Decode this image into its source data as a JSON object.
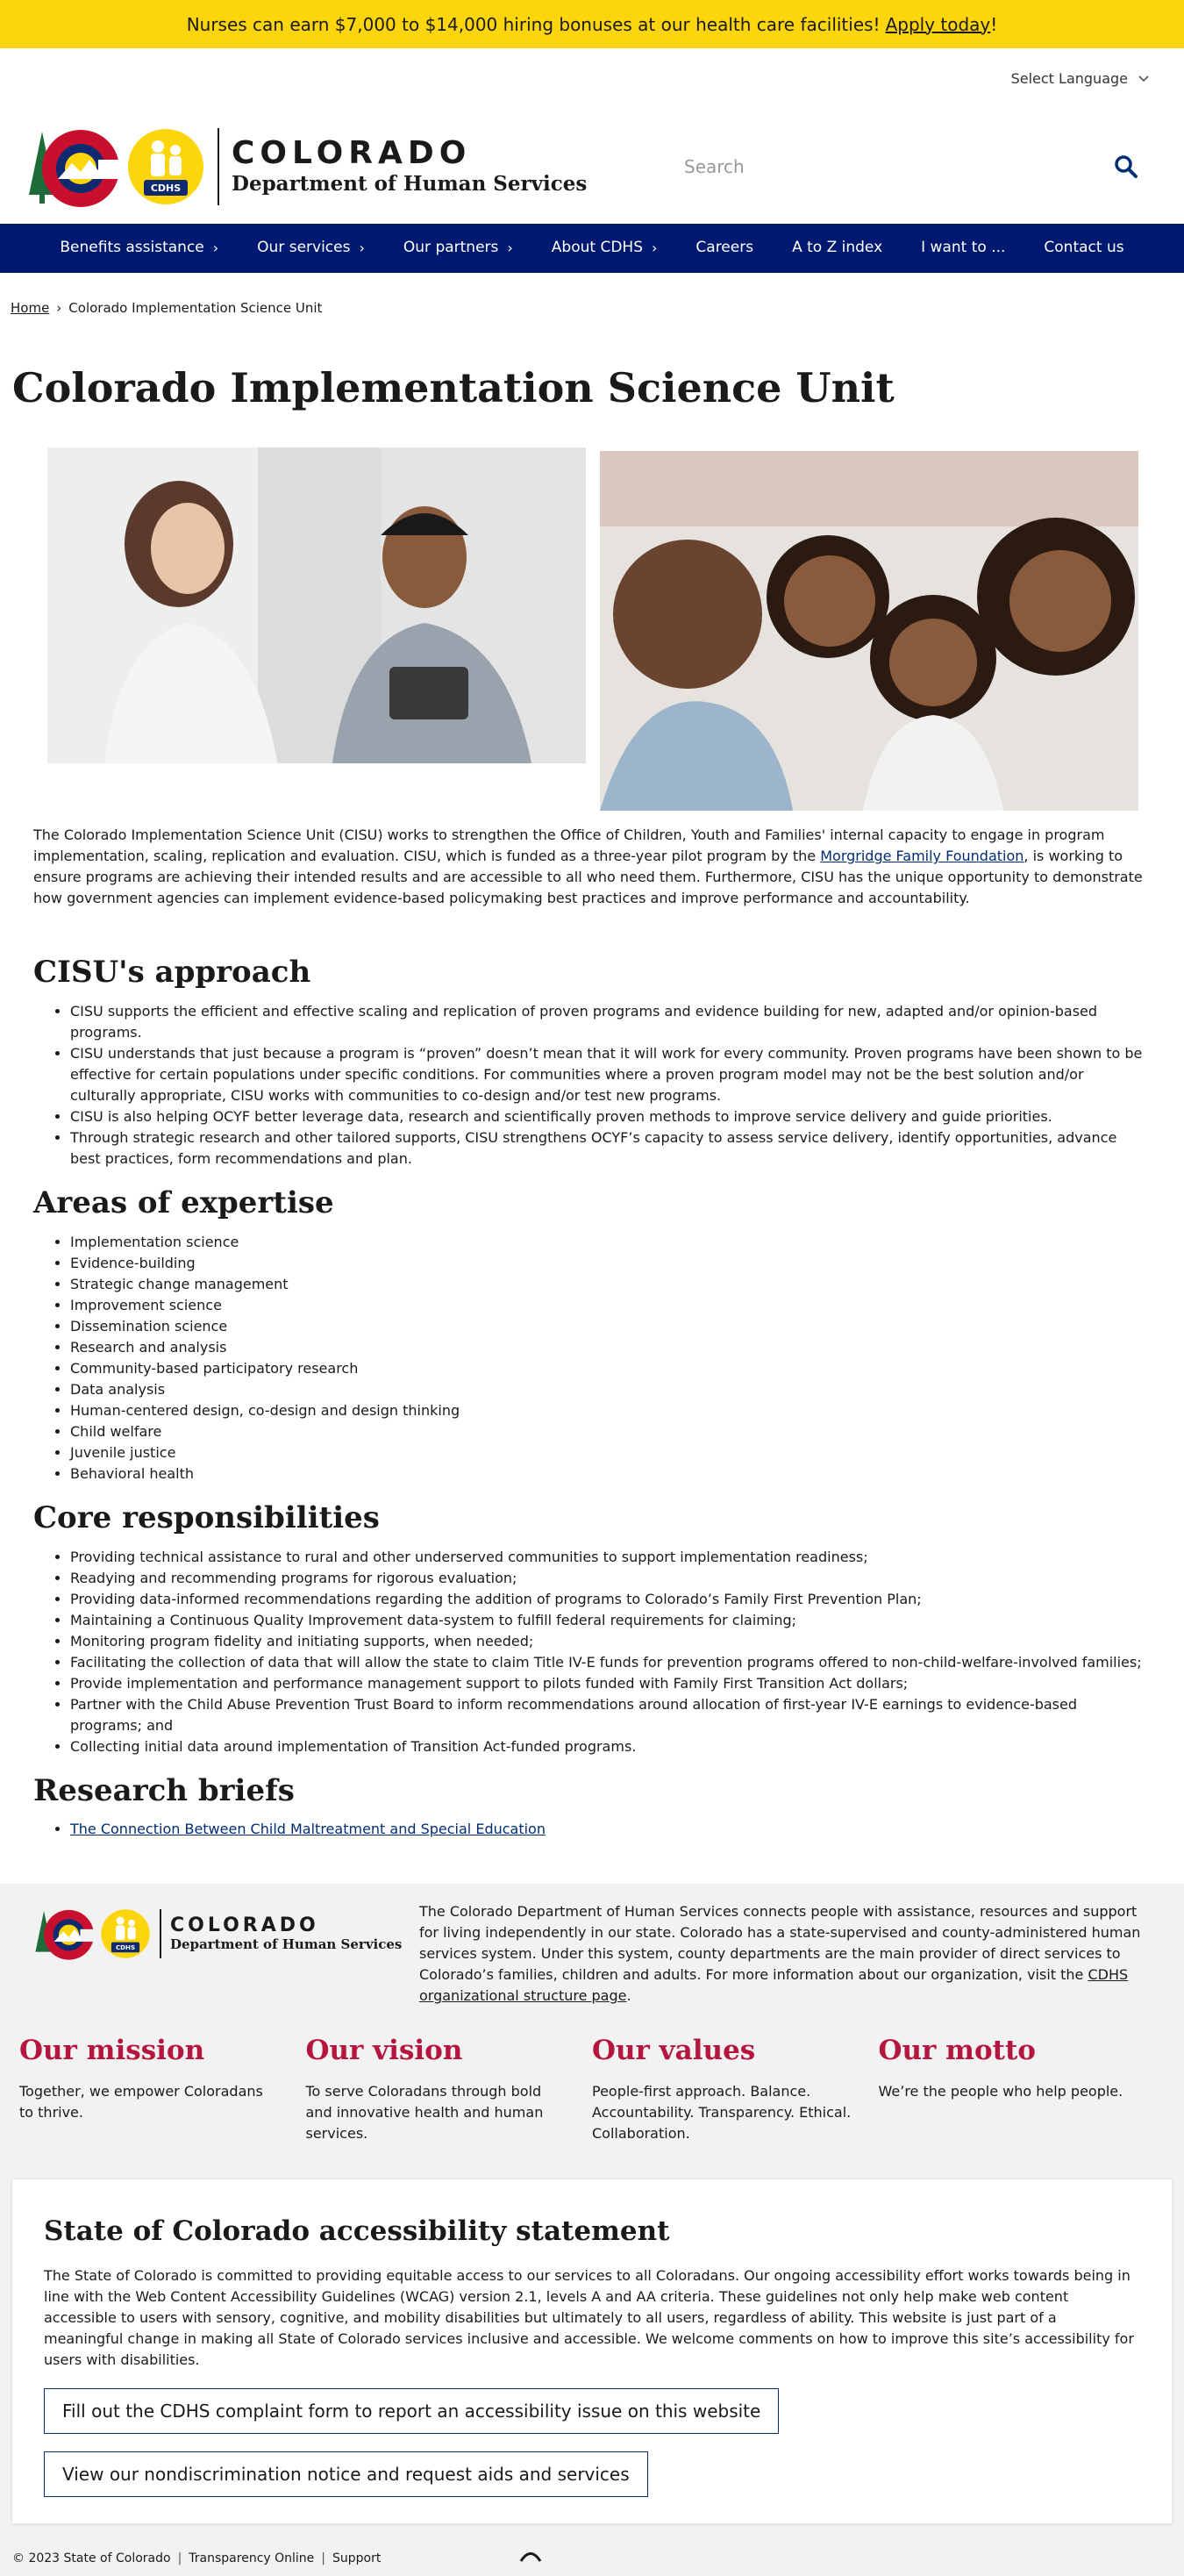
{
  "alert": {
    "text": "Nurses can earn $7,000 to $14,000 hiring bonuses at our health care facilities!",
    "link": "Apply today",
    "suffix": "!"
  },
  "header": {
    "language": "Select Language",
    "logo_title": "COLORADO",
    "logo_subtitle": "Department of Human Services",
    "cdhs_badge": "CDHS",
    "search_placeholder": "Search"
  },
  "nav": [
    {
      "label": "Benefits assistance",
      "has_chevron": true
    },
    {
      "label": "Our services",
      "has_chevron": true
    },
    {
      "label": "Our partners",
      "has_chevron": true
    },
    {
      "label": "About CDHS",
      "has_chevron": true
    },
    {
      "label": "Careers",
      "has_chevron": false
    },
    {
      "label": "A to Z index",
      "has_chevron": false
    },
    {
      "label": "I want to ...",
      "has_chevron": false
    },
    {
      "label": "Contact us",
      "has_chevron": false
    }
  ],
  "breadcrumb": {
    "home": "Home",
    "current": "Colorado Implementation Science Unit"
  },
  "page_title": "Colorado Implementation Science Unit",
  "intro": {
    "part1": "The Colorado Implementation Science Unit (CISU) works to strengthen the Office of Children, Youth and Families' internal capacity to engage in program implementation, scaling, replication and evaluation. CISU, which is funded as a three-year pilot program by the ",
    "link": "Morgridge Family Foundation",
    "part2": ", is working to ensure programs are achieving their intended results and are accessible to all who need them. Furthermore, CISU has the unique opportunity to demonstrate how government agencies can implement evidence-based policymaking best practices and improve performance and accountability."
  },
  "approach": {
    "title": "CISU's approach",
    "items": [
      "CISU supports the efficient and effective scaling and replication of proven programs and evidence building for new, adapted and/or opinion-based programs.",
      "CISU understands that just because a program is “proven” doesn’t mean that it will work for every community. Proven programs have been shown to be effective for certain populations under specific conditions. For communities where a proven program model may not be the best solution and/or culturally appropriate, CISU works with communities to co-design and/or test new programs.",
      "CISU is also helping OCYF better leverage data, research and scientifically proven methods to improve service delivery and guide priorities.",
      "Through strategic research and other tailored supports, CISU strengthens OCYF’s capacity to assess service delivery, identify opportunities, advance best practices, form recommendations and plan."
    ]
  },
  "expertise": {
    "title": "Areas of expertise",
    "items": [
      "Implementation science",
      "Evidence-building",
      "Strategic change management",
      "Improvement science",
      "Dissemination science",
      "Research and analysis",
      "Community-based participatory research",
      "Data analysis",
      "Human-centered design, co-design and design thinking",
      "Child welfare",
      "Juvenile justice",
      "Behavioral health"
    ]
  },
  "responsibilities": {
    "title": "Core responsibilities",
    "items": [
      "Providing technical assistance to rural and other underserved communities to support implementation readiness;",
      "Readying and recommending programs for rigorous evaluation;",
      "Providing data-informed recommendations regarding the addition of programs to Colorado’s Family First Prevention Plan;",
      "Maintaining a Continuous Quality Improvement data-system to fulfill federal requirements for claiming;",
      "Monitoring program fidelity and initiating supports, when needed;",
      "Facilitating the collection of data that will allow the state to claim Title IV-E funds for prevention programs offered to non-child-welfare-involved families;",
      "Provide implementation and performance management support to pilots funded with Family First Transition Act dollars;",
      "Partner with the Child Abuse Prevention Trust Board to inform recommendations around allocation of first-year IV-E earnings to evidence-based programs; and",
      "Collecting initial data around implementation of Transition Act-funded programs."
    ]
  },
  "research": {
    "title": "Research briefs",
    "links": [
      "The Connection Between Child Maltreatment and Special Education"
    ]
  },
  "footer": {
    "about": "The Colorado Department of Human Services connects people with assistance, resources and support for living independently in our state. Colorado has a state-supervised and county-administered human services system. Under this system, county departments are the main provider of direct services to Colorado’s families, children and adults. For more information about our organization, visit the ",
    "about_link": "CDHS organizational structure page",
    "about_suffix": ".",
    "values": [
      {
        "title": "Our mission",
        "text": "Together, we empower Coloradans to thrive."
      },
      {
        "title": "Our vision",
        "text": "To serve Coloradans through bold and innovative health and human services."
      },
      {
        "title": "Our values",
        "text": "People-first approach. Balance. Accountability. Transparency. Ethical. Collaboration."
      },
      {
        "title": "Our motto",
        "text": "We’re the people who help people."
      }
    ],
    "accessibility": {
      "title": "State of Colorado accessibility statement",
      "text": "The State of Colorado is committed to providing equitable access to our services to all Coloradans. Our ongoing accessibility effort works towards being in line with the Web Content Accessibility Guidelines (WCAG) version 2.1, levels A and AA criteria. These guidelines not only help make web content accessible to users with sensory, cognitive, and mobility disabilities but ultimately to all users, regardless of ability. This website is just part of a meaningful change in making all State of Colorado services inclusive and accessible. We welcome comments on how to improve this site’s accessibility for users with disabilities.",
      "button1": "Fill out the CDHS complaint form to report an accessibility issue on this website",
      "button2": "View our nondiscrimination notice and request aids and services"
    },
    "bottom": {
      "copyright": "© 2023 State of Colorado",
      "transparency": "Transparency Online",
      "support": "Support"
    }
  },
  "colors": {
    "alert_bg": "#fdd50d",
    "nav_bg": "#001970",
    "value_title": "#b5163f",
    "link": "#002d74"
  }
}
